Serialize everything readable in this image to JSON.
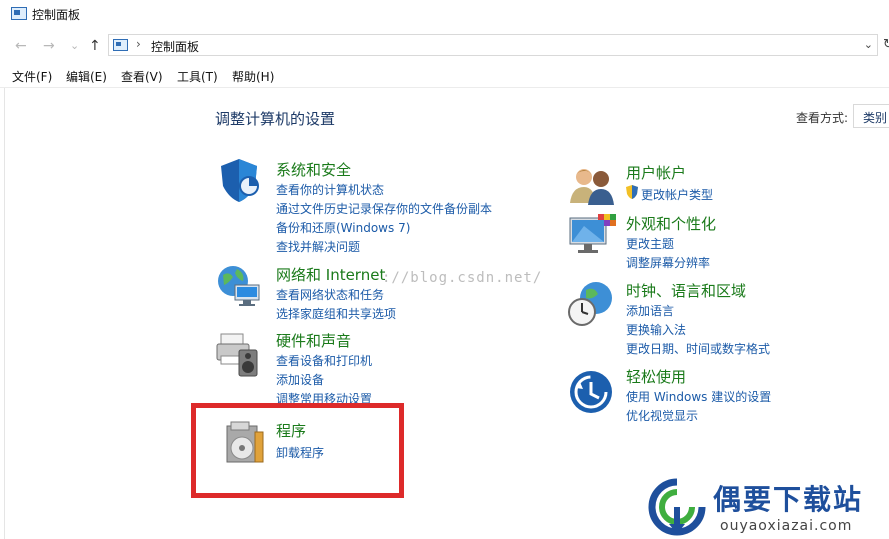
{
  "window": {
    "title": "控制面板"
  },
  "address": {
    "crumb": "控制面板",
    "separator": "›"
  },
  "nav": {
    "back": "←",
    "forward": "→",
    "recent": "⌄",
    "up": "↑",
    "dropdown": "⌄",
    "refresh": "↻"
  },
  "menu": [
    "文件(F)",
    "编辑(E)",
    "查看(V)",
    "工具(T)",
    "帮助(H)"
  ],
  "main": {
    "heading": "调整计算机的设置",
    "view_by_label": "查看方式:",
    "view_by_value": "类别"
  },
  "categories": [
    {
      "name": "system-and-security",
      "icon": "shield-icon",
      "title": "系统和安全",
      "links": [
        "查看你的计算机状态",
        "通过文件历史记录保存你的文件备份副本",
        "备份和还原(Windows 7)",
        "查找并解决问题"
      ]
    },
    {
      "name": "network-and-internet",
      "icon": "network-globe-icon",
      "title": "网络和 Internet",
      "links": [
        "查看网络状态和任务",
        "选择家庭组和共享选项"
      ]
    },
    {
      "name": "hardware-and-sound",
      "icon": "printer-speaker-icon",
      "title": "硬件和声音",
      "links": [
        "查看设备和打印机",
        "添加设备",
        "调整常用移动设置"
      ]
    },
    {
      "name": "programs",
      "icon": "program-disc-icon",
      "title": "程序",
      "links": [
        "卸载程序"
      ]
    },
    {
      "name": "user-accounts",
      "icon": "users-icon",
      "title": "用户帐户",
      "links": [
        "更改帐户类型"
      ]
    },
    {
      "name": "appearance-and-personalization",
      "icon": "monitor-palette-icon",
      "title": "外观和个性化",
      "links": [
        "更改主题",
        "调整屏幕分辨率"
      ]
    },
    {
      "name": "clock-language-region",
      "icon": "clock-globe-icon",
      "title": "时钟、语言和区域",
      "links": [
        "添加语言",
        "更换输入法",
        "更改日期、时间或数字格式"
      ]
    },
    {
      "name": "ease-of-access",
      "icon": "ease-of-access-icon",
      "title": "轻松使用",
      "links": [
        "使用 Windows 建议的设置",
        "优化视觉显示"
      ]
    }
  ],
  "watermark": "://blog.csdn.net/",
  "brand": {
    "name": "偶要下载站",
    "url": "ouyaoxiazai.com"
  },
  "colors": {
    "category_title": "#1a7a1a",
    "link": "#1c5ba8",
    "heading": "#1d3a67",
    "highlight": "#dd2a2a",
    "brand": "#1e4f9c"
  }
}
